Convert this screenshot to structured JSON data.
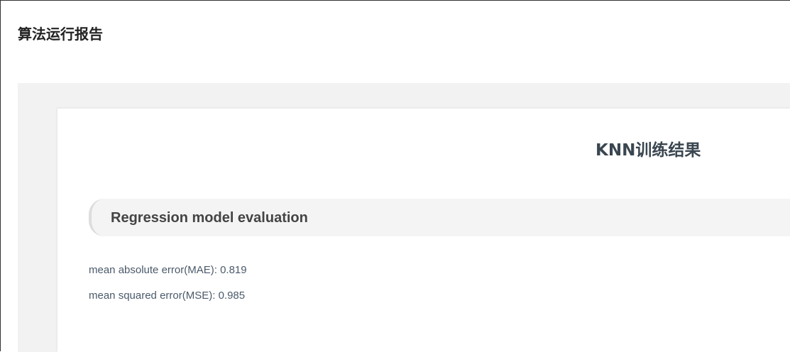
{
  "report": {
    "title": "算法运行报告"
  },
  "result": {
    "title": "KNN训练结果",
    "section_label": "Regression model evaluation",
    "metrics": [
      {
        "text": "mean absolute error(MAE): 0.819"
      },
      {
        "text": "mean squared error(MSE): 0.985"
      }
    ]
  }
}
